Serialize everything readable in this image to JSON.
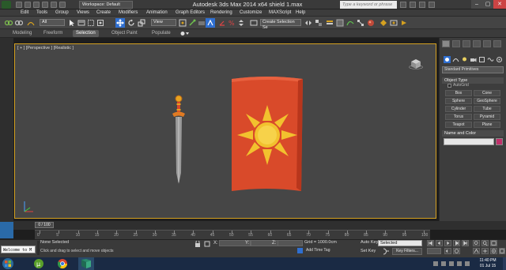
{
  "titlebar": {
    "workspace": "Workspace: Default",
    "app_title": "Autodesk 3ds Max  2014 x64     shield 1.max",
    "search_placeholder": "Type a keyword or phrase",
    "window_buttons": [
      "–",
      "▢",
      "✕"
    ]
  },
  "menu": [
    "Edit",
    "Tools",
    "Group",
    "Views",
    "Create",
    "Modifiers",
    "Animation",
    "Graph Editors",
    "Rendering",
    "Customize",
    "MAXScript",
    "Help"
  ],
  "toolbar": {
    "selection_filter": "All",
    "reference_coord": "View",
    "named_selection_placeholder": "Create Selection Se"
  },
  "ribbon_tabs": [
    "Modeling",
    "Freeform",
    "Selection",
    "Object Paint",
    "Populate"
  ],
  "ribbon_active": "Selection",
  "viewport": {
    "label": "[ + ] [Perspective ] [Realistic ]",
    "border_color": "#d4a020"
  },
  "command_panel": {
    "category": "Standard Primitives",
    "object_type_title": "Object Type",
    "autogrid_label": "AutoGrid",
    "objects": [
      "Box",
      "Cone",
      "Sphere",
      "GeoSphere",
      "Cylinder",
      "Tube",
      "Torus",
      "Pyramid",
      "Teapot",
      "Plane"
    ],
    "name_color_title": "Name and Color",
    "object_color": "#c0306a"
  },
  "timeline": {
    "frame": "0 / 100",
    "ticks": [
      "0",
      "5",
      "10",
      "15",
      "20",
      "25",
      "30",
      "35",
      "40",
      "45",
      "50",
      "55",
      "60",
      "65",
      "70",
      "75",
      "80",
      "85",
      "90",
      "95",
      "100"
    ]
  },
  "status": {
    "maxscript": "Welcome to M",
    "selection": "None Selected",
    "prompt": "Click and drag to select and move objects",
    "x_label": "X:",
    "y_label": "Y:",
    "z_label": "Z:",
    "grid": "Grid = 1000.0cm",
    "add_time_tag": "Add Time Tag",
    "auto_key": "Auto Key",
    "set_key": "Set Key",
    "selected_mode": "Selected",
    "key_filters": "Key Filters..."
  },
  "taskbar": {
    "time": "11:40 PM",
    "date": "01 Jul 15"
  },
  "colors": {
    "shield_red": "#d94a2a",
    "sun_yellow": "#f2c12e",
    "accent_gold": "#d4a020"
  }
}
